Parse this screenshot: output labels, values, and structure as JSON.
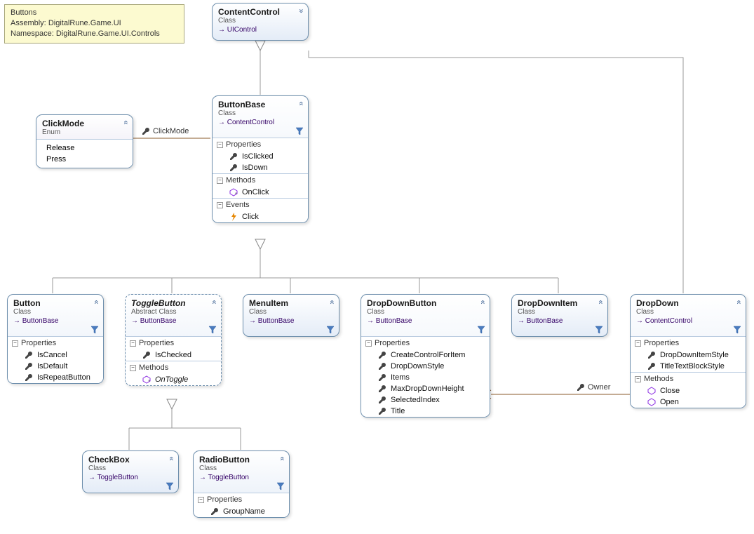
{
  "info": {
    "title": "Buttons",
    "assembly_label": "Assembly:",
    "assembly": "DigitalRune.Game.UI",
    "namespace_label": "Namespace:",
    "namespace": "DigitalRune.Game.UI.Controls"
  },
  "labels": {
    "properties": "Properties",
    "methods": "Methods",
    "events": "Events"
  },
  "assoc": {
    "clickmode": "ClickMode",
    "owner": "Owner"
  },
  "classes": {
    "ContentControl": {
      "title": "ContentControl",
      "stereo": "Class",
      "inherits": "UIControl"
    },
    "ClickMode": {
      "title": "ClickMode",
      "stereo": "Enum",
      "values": [
        "Release",
        "Press"
      ]
    },
    "ButtonBase": {
      "title": "ButtonBase",
      "stereo": "Class",
      "inherits": "ContentControl",
      "properties": [
        "IsClicked",
        "IsDown"
      ],
      "methods": [
        "OnClick"
      ],
      "events": [
        "Click"
      ]
    },
    "Button": {
      "title": "Button",
      "stereo": "Class",
      "inherits": "ButtonBase",
      "properties": [
        "IsCancel",
        "IsDefault",
        "IsRepeatButton"
      ]
    },
    "ToggleButton": {
      "title": "ToggleButton",
      "stereo": "Abstract Class",
      "inherits": "ButtonBase",
      "properties": [
        "IsChecked"
      ],
      "methods": [
        "OnToggle"
      ]
    },
    "MenuItem": {
      "title": "MenuItem",
      "stereo": "Class",
      "inherits": "ButtonBase"
    },
    "DropDownButton": {
      "title": "DropDownButton",
      "stereo": "Class",
      "inherits": "ButtonBase",
      "properties": [
        "CreateControlForItem",
        "DropDownStyle",
        "Items",
        "MaxDropDownHeight",
        "SelectedIndex",
        "Title"
      ]
    },
    "DropDownItem": {
      "title": "DropDownItem",
      "stereo": "Class",
      "inherits": "ButtonBase"
    },
    "DropDown": {
      "title": "DropDown",
      "stereo": "Class",
      "inherits": "ContentControl",
      "properties": [
        "DropDownItemStyle",
        "TitleTextBlockStyle"
      ],
      "methods": [
        "Close",
        "Open"
      ]
    },
    "CheckBox": {
      "title": "CheckBox",
      "stereo": "Class",
      "inherits": "ToggleButton"
    },
    "RadioButton": {
      "title": "RadioButton",
      "stereo": "Class",
      "inherits": "ToggleButton",
      "properties": [
        "GroupName"
      ]
    }
  }
}
